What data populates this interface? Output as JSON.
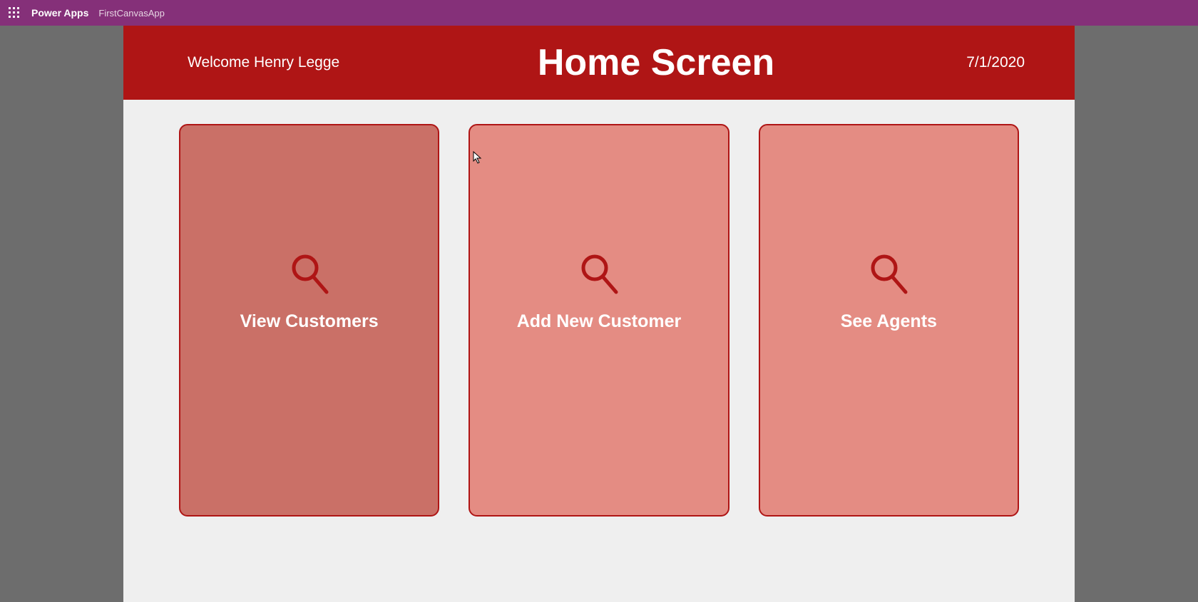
{
  "topbar": {
    "brand": "Power Apps",
    "app_name": "FirstCanvasApp"
  },
  "header": {
    "welcome": "Welcome Henry Legge",
    "title": "Home Screen",
    "date": "7/1/2020"
  },
  "tiles": [
    {
      "label": "View Customers",
      "icon": "search-icon",
      "hovered": true
    },
    {
      "label": "Add New Customer",
      "icon": "search-icon",
      "hovered": false
    },
    {
      "label": "See Agents",
      "icon": "search-icon",
      "hovered": false
    }
  ],
  "colors": {
    "accent_purple": "#853079",
    "header_red": "#af1515",
    "tile_normal": "#e48c83",
    "tile_hover": "#ca7067",
    "canvas_bg": "#efefef",
    "outer_bg": "#6d6d6d"
  }
}
